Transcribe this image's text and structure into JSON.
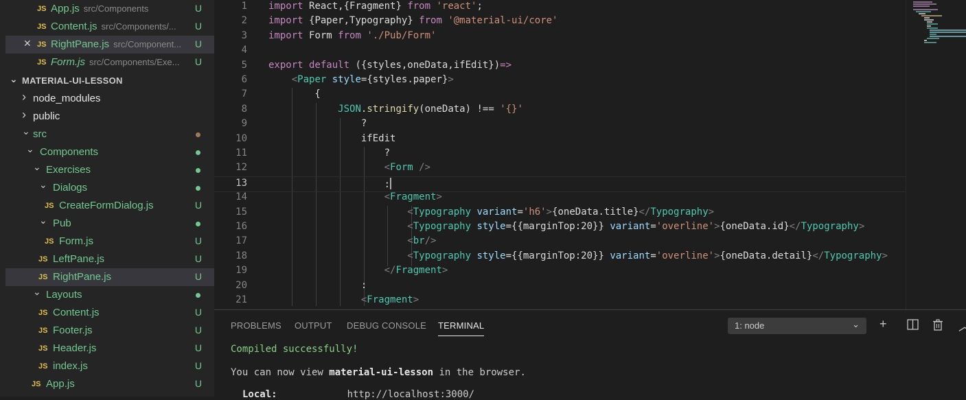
{
  "open_editors": [
    {
      "name": "App.js",
      "path": "src/Components",
      "status": "U",
      "italic": false,
      "active": false
    },
    {
      "name": "Content.js",
      "path": "src/Components/...",
      "status": "U",
      "italic": false,
      "active": false
    },
    {
      "name": "RightPane.js",
      "path": "src/Component...",
      "status": "U",
      "italic": false,
      "active": true
    },
    {
      "name": "Form.js",
      "path": "src/Components/Exe...",
      "status": "U",
      "italic": true,
      "active": false
    }
  ],
  "file_badge": "JS",
  "close_glyph": "✕",
  "project": {
    "title": "MATERIAL-UI-LESSON"
  },
  "tree": [
    {
      "label": "node_modules",
      "kind": "folder-closed"
    },
    {
      "label": "public",
      "kind": "folder-closed"
    },
    {
      "label": "src",
      "kind": "folder-open"
    },
    {
      "label": "Components",
      "kind": "folder-open"
    },
    {
      "label": "Exercises",
      "kind": "folder-open"
    },
    {
      "label": "Dialogs",
      "kind": "folder-open"
    },
    {
      "label": "CreateFormDialog.js",
      "kind": "file",
      "status": "U"
    },
    {
      "label": "Pub",
      "kind": "folder-open"
    },
    {
      "label": "Form.js",
      "kind": "file",
      "status": "U"
    },
    {
      "label": "LeftPane.js",
      "kind": "file",
      "status": "U"
    },
    {
      "label": "RightPane.js",
      "kind": "file",
      "status": "U"
    },
    {
      "label": "Layouts",
      "kind": "folder-open"
    },
    {
      "label": "Content.js",
      "kind": "file",
      "status": "U"
    },
    {
      "label": "Footer.js",
      "kind": "file",
      "status": "U"
    },
    {
      "label": "Header.js",
      "kind": "file",
      "status": "U"
    },
    {
      "label": "index.js",
      "kind": "file",
      "status": "U"
    },
    {
      "label": "App.js",
      "kind": "file",
      "status": "U"
    }
  ],
  "editor": {
    "line_numbers": [
      "1",
      "2",
      "3",
      "4",
      "5",
      "6",
      "7",
      "8",
      "9",
      "10",
      "11",
      "12",
      "13",
      "14",
      "15",
      "16",
      "17",
      "18",
      "19",
      "20",
      "21"
    ],
    "current_line": "13",
    "lines": [
      [
        [
          "kw",
          "import "
        ],
        [
          "ident",
          "React,{Fragment} "
        ],
        [
          "kw",
          "from "
        ],
        [
          "str",
          "'react'"
        ],
        [
          "ident",
          ";"
        ]
      ],
      [
        [
          "kw",
          "import "
        ],
        [
          "ident",
          "{Paper,Typography} "
        ],
        [
          "kw",
          "from "
        ],
        [
          "str",
          "'@material-ui/core'"
        ]
      ],
      [
        [
          "kw",
          "import "
        ],
        [
          "ident",
          "Form "
        ],
        [
          "kw",
          "from "
        ],
        [
          "str",
          "'./Pub/Form'"
        ]
      ],
      [],
      [
        [
          "kw",
          "export default "
        ],
        [
          "ident",
          "({styles,oneData,ifEdit})"
        ],
        [
          "kw",
          "=>"
        ]
      ],
      [
        [
          "punct",
          "    <"
        ],
        [
          "tag",
          "Paper "
        ],
        [
          "attr",
          "style"
        ],
        [
          "ident",
          "={styles.paper}"
        ],
        [
          "punct",
          ">"
        ]
      ],
      [
        [
          "ident",
          "        {"
        ]
      ],
      [
        [
          "ident",
          "            "
        ],
        [
          "typ",
          "JSON"
        ],
        [
          "ident",
          "."
        ],
        [
          "fn",
          "stringify"
        ],
        [
          "ident",
          "(oneData) !== "
        ],
        [
          "str",
          "'{}'"
        ]
      ],
      [
        [
          "ident",
          "                ?"
        ]
      ],
      [
        [
          "ident",
          "                ifEdit"
        ]
      ],
      [
        [
          "ident",
          "                    ?"
        ]
      ],
      [
        [
          "punct",
          "                    <"
        ],
        [
          "tag",
          "Form "
        ],
        [
          "punct",
          "/>"
        ]
      ],
      [
        [
          "ident",
          "                    :"
        ]
      ],
      [
        [
          "punct",
          "                    <"
        ],
        [
          "tag",
          "Fragment"
        ],
        [
          "punct",
          ">"
        ]
      ],
      [
        [
          "punct",
          "                        <"
        ],
        [
          "tag",
          "Typography "
        ],
        [
          "attr",
          "variant"
        ],
        [
          "ident",
          "="
        ],
        [
          "str",
          "'h6'"
        ],
        [
          "punct",
          ">"
        ],
        [
          "ident",
          "{oneData.title}"
        ],
        [
          "punct",
          "</"
        ],
        [
          "tag",
          "Typography"
        ],
        [
          "punct",
          ">"
        ]
      ],
      [
        [
          "punct",
          "                        <"
        ],
        [
          "tag",
          "Typography "
        ],
        [
          "attr",
          "style"
        ],
        [
          "ident",
          "={{marginTop:20}} "
        ],
        [
          "attr",
          "variant"
        ],
        [
          "ident",
          "="
        ],
        [
          "str",
          "'overline'"
        ],
        [
          "punct",
          ">"
        ],
        [
          "ident",
          "{oneData.id}"
        ],
        [
          "punct",
          "</"
        ],
        [
          "tag",
          "Typography"
        ],
        [
          "punct",
          ">"
        ]
      ],
      [
        [
          "punct",
          "                        <"
        ],
        [
          "tag",
          "br"
        ],
        [
          "punct",
          "/>"
        ]
      ],
      [
        [
          "punct",
          "                        <"
        ],
        [
          "tag",
          "Typography "
        ],
        [
          "attr",
          "style"
        ],
        [
          "ident",
          "={{marginTop:20}} "
        ],
        [
          "attr",
          "variant"
        ],
        [
          "ident",
          "="
        ],
        [
          "str",
          "'overline'"
        ],
        [
          "punct",
          ">"
        ],
        [
          "ident",
          "{oneData.detail}"
        ],
        [
          "punct",
          "</"
        ],
        [
          "tag",
          "Typography"
        ],
        [
          "punct",
          ">"
        ]
      ],
      [
        [
          "punct",
          "                    </"
        ],
        [
          "tag",
          "Fragment"
        ],
        [
          "punct",
          ">"
        ]
      ],
      [
        [
          "ident",
          "                :"
        ]
      ],
      [
        [
          "punct",
          "                <"
        ],
        [
          "tag",
          "Fragment"
        ],
        [
          "punct",
          ">"
        ]
      ]
    ]
  },
  "panel": {
    "tabs": [
      "PROBLEMS",
      "OUTPUT",
      "DEBUG CONSOLE",
      "TERMINAL"
    ],
    "active_tab": "TERMINAL",
    "terminal_select": "1: node",
    "icons": {
      "add": "+",
      "split": "split-icon",
      "trash": "trash-icon",
      "chevron": "chevron-up-icon"
    },
    "terminal": {
      "compiled": "Compiled successfully!",
      "view_prefix": "You can now view ",
      "view_app": "material-ui-lesson",
      "view_suffix": " in the browser.",
      "local_label": "Local:",
      "local_url": "http://localhost:3000/"
    }
  },
  "colors": {
    "accent_green": "#73c991",
    "js_yellow": "#e2c04d",
    "string": "#ce9178",
    "keyword": "#c586c0",
    "tag": "#4ec9b0"
  }
}
